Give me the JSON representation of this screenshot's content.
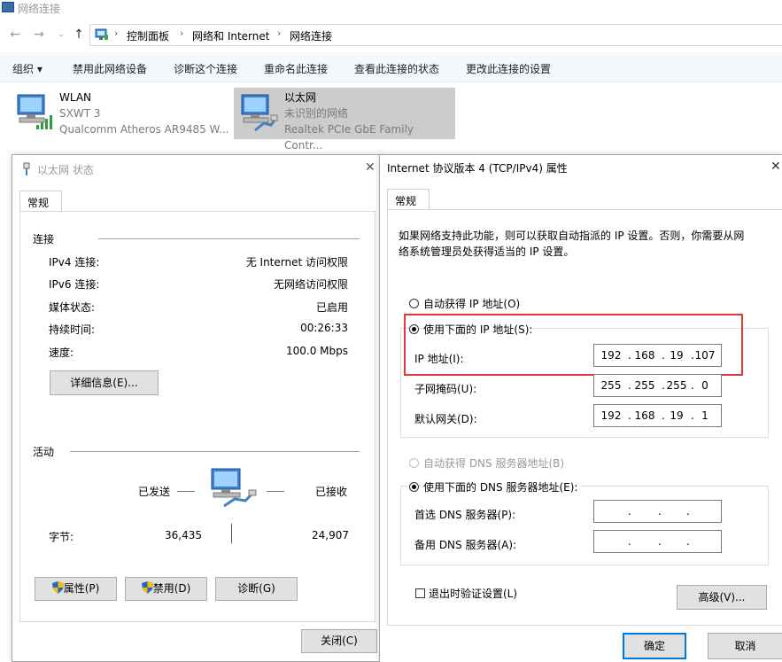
{
  "window": {
    "title": "网络连接"
  },
  "breadcrumb": [
    "控制面板",
    "网络和 Internet",
    "网络连接"
  ],
  "command_bar": [
    "组织 ▾",
    "禁用此网络设备",
    "诊断这个连接",
    "重命名此连接",
    "查看此连接的状态",
    "更改此连接的设置"
  ],
  "adapters": [
    {
      "name": "WLAN",
      "status": "SXWT 3",
      "device": "Qualcomm Atheros AR9485 W..."
    },
    {
      "name": "以太网",
      "status": "未识别的网络",
      "device": "Realtek PCIe GbE Family Contr..."
    }
  ],
  "status_dialog": {
    "title": "以太网 状态",
    "tab": "常规",
    "connection_header": "连接",
    "rows": [
      {
        "label": "IPv4 连接:",
        "value": "无 Internet 访问权限"
      },
      {
        "label": "IPv6 连接:",
        "value": "无网络访问权限"
      },
      {
        "label": "媒体状态:",
        "value": "已启用"
      },
      {
        "label": "持续时间:",
        "value": "00:26:33"
      },
      {
        "label": "速度:",
        "value": "100.0 Mbps"
      }
    ],
    "details_button": "详细信息(E)...",
    "activity_header": "活动",
    "sent_label": "已发送",
    "received_label": "已接收",
    "bytes_label": "字节:",
    "bytes_sent": "36,435",
    "bytes_received": "24,907",
    "properties_button": "属性(P)",
    "disable_button": "禁用(D)",
    "diagnose_button": "诊断(G)",
    "close_button": "关闭(C)"
  },
  "ipv4_dialog": {
    "title": "Internet 协议版本 4 (TCP/IPv4) 属性",
    "tab": "常规",
    "description_line1": "如果网络支持此功能，则可以获取自动指派的 IP 设置。否则，你需要从网",
    "description_line2": "络系统管理员处获得适当的 IP 设置。",
    "auto_ip": "自动获得 IP 地址(O)",
    "manual_ip": "使用下面的 IP 地址(S):",
    "ip_label": "IP 地址(I):",
    "ip_address": [
      "192",
      "168",
      "19",
      "107"
    ],
    "subnet_label": "子网掩码(U):",
    "subnet_mask": [
      "255",
      "255",
      "255",
      "0"
    ],
    "gateway_label": "默认网关(D):",
    "gateway": [
      "192",
      "168",
      "19",
      "1"
    ],
    "auto_dns": "自动获得 DNS 服务器地址(B)",
    "manual_dns": "使用下面的 DNS 服务器地址(E):",
    "preferred_dns_label": "首选 DNS 服务器(P):",
    "alternate_dns_label": "备用 DNS 服务器(A):",
    "preferred_dns": [
      "",
      "",
      "",
      ""
    ],
    "alternate_dns": [
      "",
      "",
      "",
      ""
    ],
    "validate_label": "退出时验证设置(L)",
    "advanced_button": "高级(V)...",
    "ok_button": "确定",
    "cancel_button": "取消"
  },
  "colors": {
    "highlight_box": "#e53935",
    "accent": "#0078d7",
    "selected_adapter": "#cccccc"
  },
  "icons": [
    "network-adapter-icon",
    "wifi-signal-icon",
    "cable-icon",
    "shield-icon",
    "close-icon",
    "back-icon",
    "forward-icon",
    "up-icon",
    "control-panel-icon"
  ]
}
